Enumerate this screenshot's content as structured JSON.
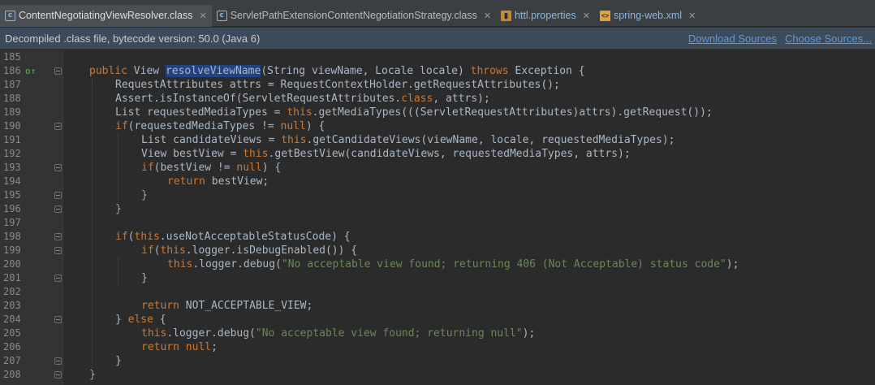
{
  "tabs": [
    {
      "label": "ContentNegotiatingViewResolver.class",
      "icon": "class-file-icon",
      "active": true
    },
    {
      "label": "ServletPathExtensionContentNegotiationStrategy.class",
      "icon": "class-file-icon",
      "active": false
    },
    {
      "label": "httl.properties",
      "icon": "properties-file-icon",
      "active": false
    },
    {
      "label": "spring-web.xml",
      "icon": "xml-file-icon",
      "active": false
    }
  ],
  "banner": {
    "text": "Decompiled .class file, bytecode version: 50.0 (Java 6)",
    "download_sources": "Download Sources",
    "choose_sources": "Choose Sources..."
  },
  "colors": {
    "keyword": "#cc7832",
    "string": "#6a8759",
    "text": "#a9b7c6",
    "selection": "#214283",
    "banner_link": "#5b9bde"
  },
  "code_lines": [
    {
      "n": "185",
      "indent": 0,
      "tokens": []
    },
    {
      "n": "186",
      "indent": 0,
      "mark": "o↑",
      "fold": true,
      "tokens": [
        [
          "kw",
          "public "
        ],
        [
          "t",
          "View "
        ],
        [
          "sel",
          "resolveViewName"
        ],
        [
          "t",
          "(String viewName, Locale locale) "
        ],
        [
          "kw",
          "throws "
        ],
        [
          "t",
          "Exception {"
        ]
      ]
    },
    {
      "n": "187",
      "indent": 1,
      "tokens": [
        [
          "t",
          "RequestAttributes attrs = RequestContextHolder.getRequestAttributes();"
        ]
      ]
    },
    {
      "n": "188",
      "indent": 1,
      "tokens": [
        [
          "t",
          "Assert.isInstanceOf(ServletRequestAttributes."
        ],
        [
          "kw",
          "class"
        ],
        [
          "t",
          ", attrs);"
        ]
      ]
    },
    {
      "n": "189",
      "indent": 1,
      "tokens": [
        [
          "t",
          "List requestedMediaTypes = "
        ],
        [
          "kw",
          "this"
        ],
        [
          "t",
          ".getMediaTypes(((ServletRequestAttributes)attrs).getRequest());"
        ]
      ]
    },
    {
      "n": "190",
      "indent": 1,
      "fold": true,
      "tokens": [
        [
          "kw",
          "if"
        ],
        [
          "t",
          "(requestedMediaTypes != "
        ],
        [
          "kw",
          "null"
        ],
        [
          "t",
          ") {"
        ]
      ]
    },
    {
      "n": "191",
      "indent": 2,
      "tokens": [
        [
          "t",
          "List candidateViews = "
        ],
        [
          "kw",
          "this"
        ],
        [
          "t",
          ".getCandidateViews(viewName, locale, requestedMediaTypes);"
        ]
      ]
    },
    {
      "n": "192",
      "indent": 2,
      "tokens": [
        [
          "t",
          "View bestView = "
        ],
        [
          "kw",
          "this"
        ],
        [
          "t",
          ".getBestView(candidateViews, requestedMediaTypes, attrs);"
        ]
      ]
    },
    {
      "n": "193",
      "indent": 2,
      "fold": true,
      "tokens": [
        [
          "kw",
          "if"
        ],
        [
          "t",
          "(bestView != "
        ],
        [
          "kw",
          "null"
        ],
        [
          "t",
          ") {"
        ]
      ]
    },
    {
      "n": "194",
      "indent": 3,
      "tokens": [
        [
          "kw",
          "return "
        ],
        [
          "t",
          "bestView;"
        ]
      ]
    },
    {
      "n": "195",
      "indent": 2,
      "fold": true,
      "tokens": [
        [
          "t",
          "}"
        ]
      ]
    },
    {
      "n": "196",
      "indent": 1,
      "fold": true,
      "tokens": [
        [
          "t",
          "}"
        ]
      ]
    },
    {
      "n": "197",
      "indent": 0,
      "tokens": []
    },
    {
      "n": "198",
      "indent": 1,
      "fold": true,
      "tokens": [
        [
          "kw",
          "if"
        ],
        [
          "t",
          "("
        ],
        [
          "kw",
          "this"
        ],
        [
          "t",
          ".useNotAcceptableStatusCode) {"
        ]
      ]
    },
    {
      "n": "199",
      "indent": 2,
      "fold": true,
      "tokens": [
        [
          "kw",
          "if"
        ],
        [
          "t",
          "("
        ],
        [
          "kw",
          "this"
        ],
        [
          "t",
          ".logger.isDebugEnabled()) {"
        ]
      ]
    },
    {
      "n": "200",
      "indent": 3,
      "tokens": [
        [
          "kw",
          "this"
        ],
        [
          "t",
          ".logger.debug("
        ],
        [
          "str",
          "\"No acceptable view found; returning 406 (Not Acceptable) status code\""
        ],
        [
          "t",
          ");"
        ]
      ]
    },
    {
      "n": "201",
      "indent": 2,
      "fold": true,
      "tokens": [
        [
          "t",
          "}"
        ]
      ]
    },
    {
      "n": "202",
      "indent": 0,
      "tokens": []
    },
    {
      "n": "203",
      "indent": 2,
      "tokens": [
        [
          "kw",
          "return "
        ],
        [
          "t",
          "NOT_ACCEPTABLE_VIEW;"
        ]
      ]
    },
    {
      "n": "204",
      "indent": 1,
      "fold": true,
      "tokens": [
        [
          "t",
          "} "
        ],
        [
          "kw",
          "else "
        ],
        [
          "t",
          "{"
        ]
      ]
    },
    {
      "n": "205",
      "indent": 2,
      "tokens": [
        [
          "kw",
          "this"
        ],
        [
          "t",
          ".logger.debug("
        ],
        [
          "str",
          "\"No acceptable view found; returning null\""
        ],
        [
          "t",
          ");"
        ]
      ]
    },
    {
      "n": "206",
      "indent": 2,
      "tokens": [
        [
          "kw",
          "return null"
        ],
        [
          "t",
          ";"
        ]
      ]
    },
    {
      "n": "207",
      "indent": 1,
      "fold": true,
      "tokens": [
        [
          "t",
          "}"
        ]
      ]
    },
    {
      "n": "208",
      "indent": 0,
      "fold": true,
      "tokens": [
        [
          "t",
          "}"
        ]
      ]
    }
  ]
}
